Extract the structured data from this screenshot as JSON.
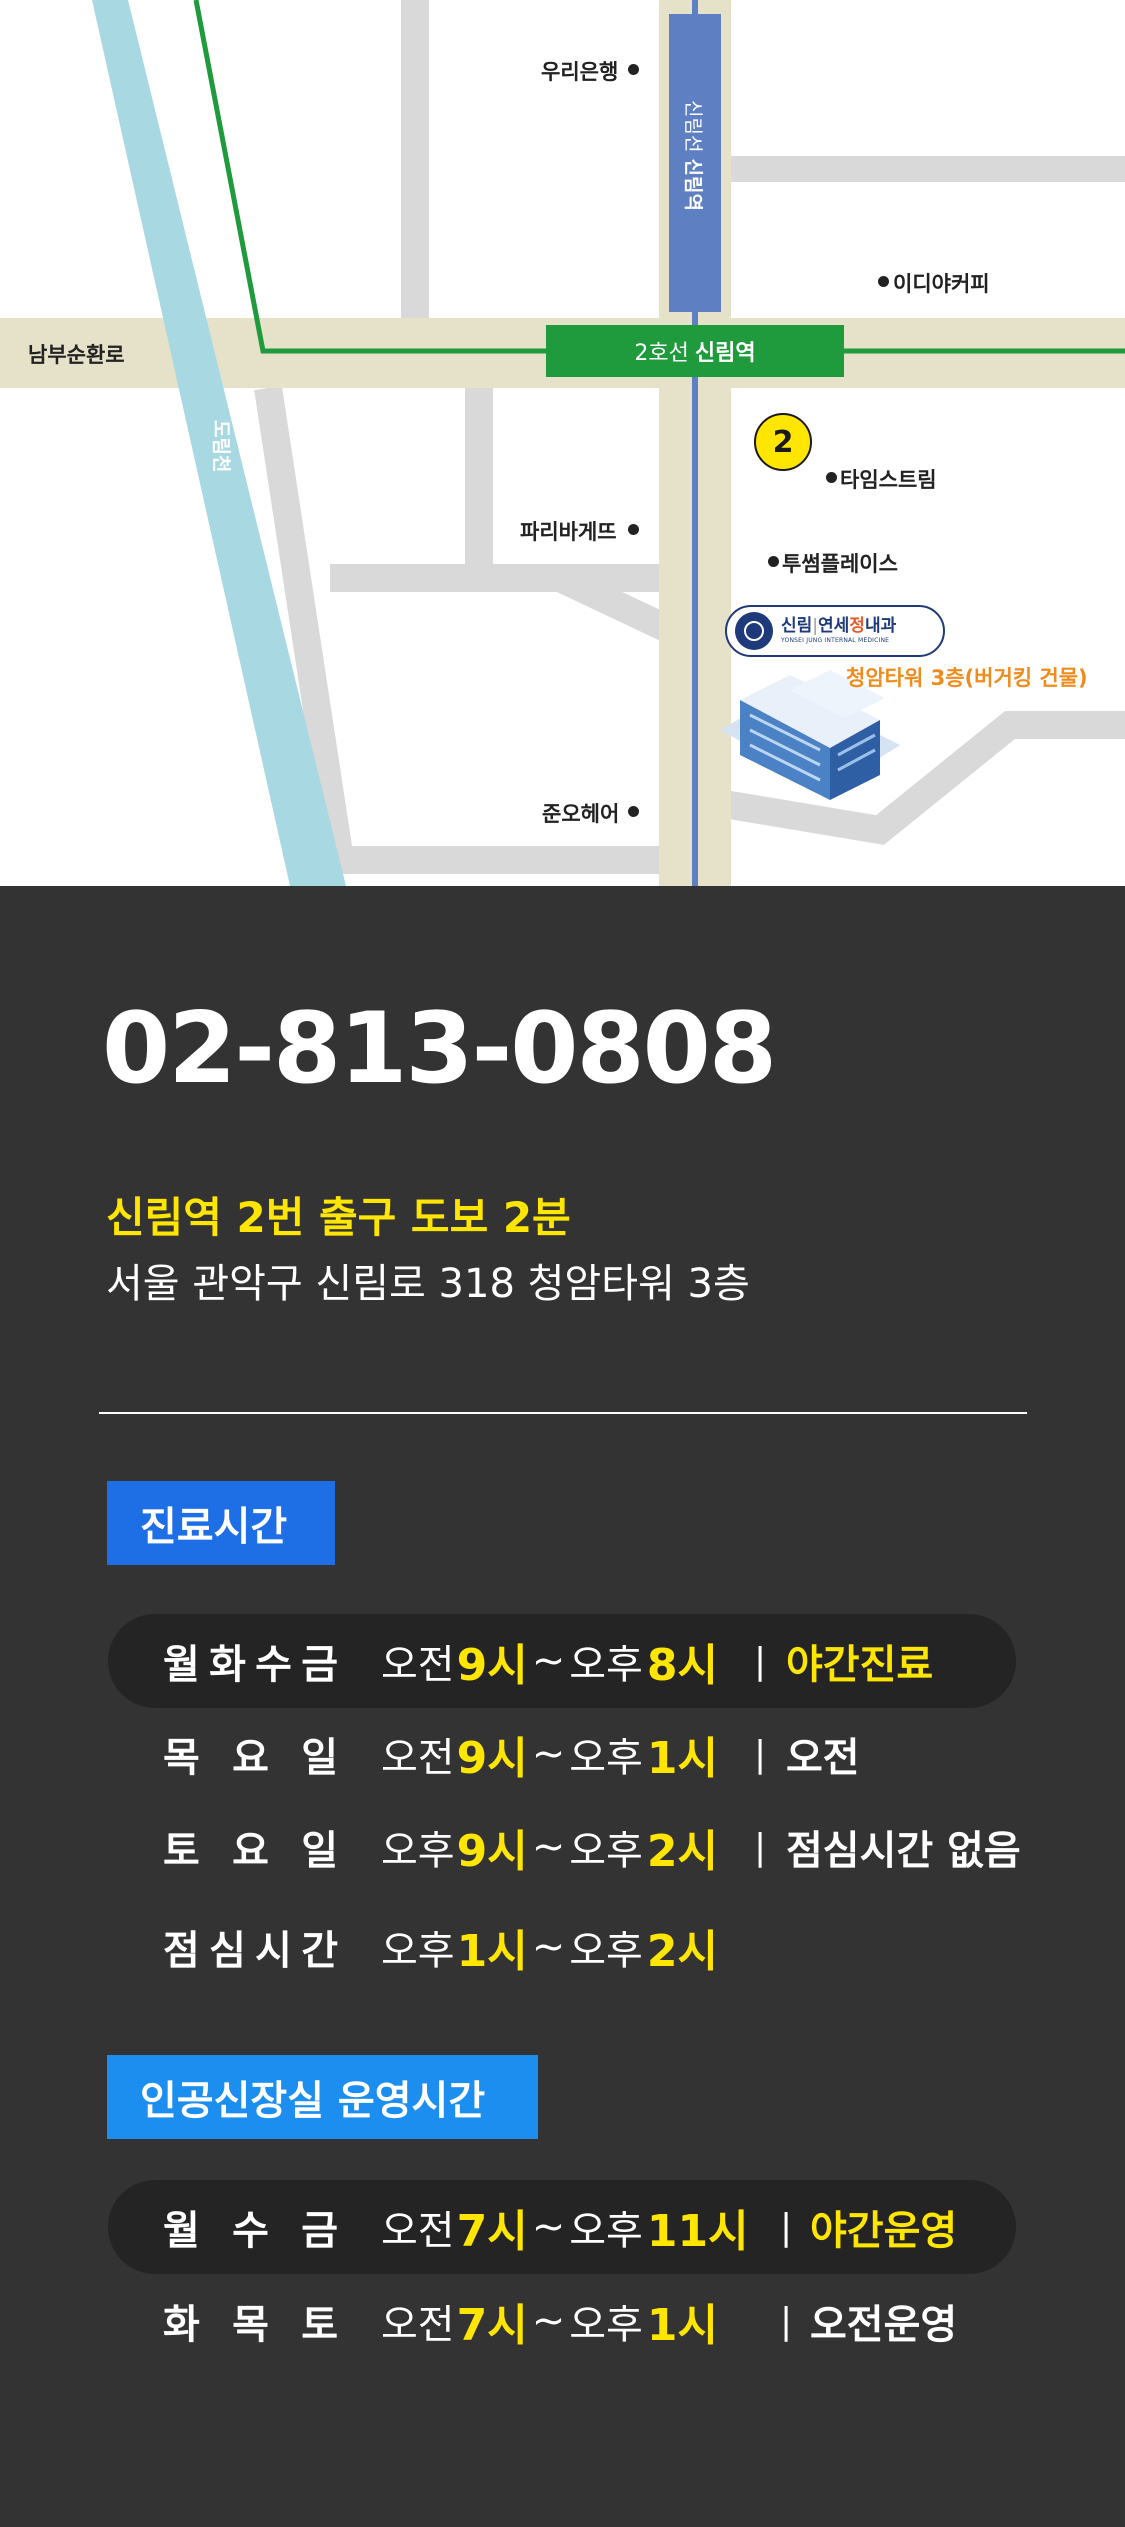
{
  "map": {
    "roads": {
      "main_road": "남부순환로",
      "stream": "도림천",
      "line_vertical": "신림선",
      "line_vertical_station": "신림역"
    },
    "station": {
      "line": "2호선",
      "name": "신림역"
    },
    "exit_number": "2",
    "landmarks": {
      "woori_bank": "우리은행",
      "ediya": "이디야커피",
      "time_stream": "타임스트림",
      "paris": "파리바게뜨",
      "twosome": "투썸플레이스",
      "juno": "준오헤어"
    },
    "clinic": {
      "name_part1": "신림",
      "name_divider": "|",
      "name_part2a": "연세",
      "name_part2b": "정",
      "name_part2c": "내과",
      "name_en": "YONSEI JUNG INTERNAL MEDICINE",
      "floor": "청암타워 3층(버거킹 건물)"
    },
    "colors": {
      "road": "#d9d9d9",
      "main_road": "#e6e1c9",
      "stream": "#a8d8e2",
      "line2": "#1f9a3c",
      "line_shillim": "#5e7fc2"
    }
  },
  "phone": "02-813-0808",
  "exit_line": "신림역 2번 출구 도보 2분",
  "address": "서울 관악구 신림로 318 청암타워 3층",
  "hours": {
    "title": "진료시간",
    "rows": [
      {
        "day": [
          "월",
          "화",
          "수",
          "금"
        ],
        "w1": "오전",
        "n1": "9시",
        "tilde": "~",
        "w2": "오후",
        "n2": "8시",
        "sep": "|",
        "note": "야간진료",
        "note_style": "yellow",
        "highlight": true
      },
      {
        "day": [
          "목",
          "요",
          "일"
        ],
        "w1": "오전",
        "n1": "9시",
        "tilde": "~",
        "w2": "오후",
        "n2": "1시",
        "sep": "|",
        "note": "오전",
        "note_style": "white",
        "highlight": false
      },
      {
        "day": [
          "토",
          "요",
          "일"
        ],
        "w1": "오후",
        "n1": "9시",
        "tilde": "~",
        "w2": "오후",
        "n2": "2시",
        "sep": "|",
        "note": "점심시간 없음",
        "note_style": "white",
        "highlight": false
      },
      {
        "day": [
          "점",
          "심",
          "시",
          "간"
        ],
        "w1": "오후",
        "n1": "1시",
        "tilde": "~",
        "w2": "오후",
        "n2": "2시",
        "sep": "",
        "note": "",
        "note_style": "white",
        "highlight": false
      }
    ]
  },
  "dialysis": {
    "title": "인공신장실 운영시간",
    "rows": [
      {
        "day": [
          "월",
          "수",
          "금"
        ],
        "w1": "오전",
        "n1": "7시",
        "tilde": "~",
        "w2": "오후",
        "n2": "11시",
        "sep": "|",
        "note": "야간운영",
        "note_style": "yellow",
        "highlight": true
      },
      {
        "day": [
          "화",
          "목",
          "토"
        ],
        "w1": "오전",
        "n1": "7시",
        "tilde": "~",
        "w2": "오후",
        "n2": "1시",
        "sep": "|",
        "note": "오전운영",
        "note_style": "white",
        "highlight": false
      }
    ]
  }
}
